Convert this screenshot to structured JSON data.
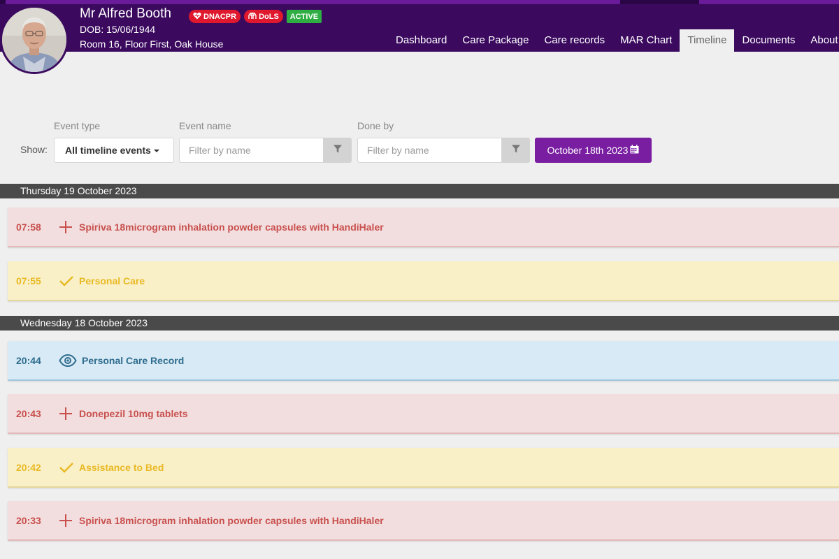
{
  "patient": {
    "name": "Mr Alfred Booth",
    "dob": "DOB: 15/06/1944",
    "room": "Room 16, Floor First, Oak House",
    "badges": [
      {
        "label": "DNACPR",
        "color": "#e0182d",
        "icon": "heart-icon"
      },
      {
        "label": "DoLS",
        "color": "#e0182d",
        "icon": "hands-icon"
      },
      {
        "label": "ACTIVE",
        "color": "#2eae43"
      }
    ]
  },
  "nav": {
    "items": [
      {
        "label": "Dashboard"
      },
      {
        "label": "Care Package"
      },
      {
        "label": "Care records"
      },
      {
        "label": "MAR Chart"
      },
      {
        "label": "Timeline",
        "active": true
      },
      {
        "label": "Documents"
      },
      {
        "label": "About I"
      }
    ]
  },
  "filters": {
    "show_label": "Show:",
    "event_type_label": "Event type",
    "event_type_value": "All timeline events",
    "event_name_label": "Event name",
    "event_name_placeholder": "Filter by name",
    "done_by_label": "Done by",
    "done_by_placeholder": "Filter by name",
    "date_label": "October 18th 2023"
  },
  "timeline": {
    "days": [
      {
        "date": "Thursday 19 October 2023",
        "events": [
          {
            "time": "07:58",
            "name": "Spiriva 18microgram inhalation powder capsules with HandiHaler",
            "type": "medication",
            "icon": "plus-icon"
          },
          {
            "time": "07:55",
            "name": "Personal Care",
            "type": "task",
            "icon": "check-icon"
          }
        ]
      },
      {
        "date": "Wednesday 18 October 2023",
        "events": [
          {
            "time": "20:44",
            "name": "Personal Care Record",
            "type": "record",
            "icon": "eye-icon"
          },
          {
            "time": "20:43",
            "name": "Donepezil 10mg tablets",
            "type": "medication",
            "icon": "plus-icon"
          },
          {
            "time": "20:42",
            "name": "Assistance to Bed",
            "type": "task",
            "icon": "check-icon"
          },
          {
            "time": "20:33",
            "name": "Spiriva 18microgram inhalation powder capsules with HandiHaler",
            "type": "medication",
            "icon": "plus-icon"
          }
        ]
      }
    ]
  },
  "colors": {
    "header_bg": "#3b0a5f",
    "accent": "#7a1ea1",
    "medication_bg": "#f2dede",
    "medication_text": "#c8504e",
    "task_bg": "#faf0c8",
    "task_text": "#e8b923",
    "record_bg": "#d8eaf5",
    "record_text": "#2e6d8f"
  }
}
